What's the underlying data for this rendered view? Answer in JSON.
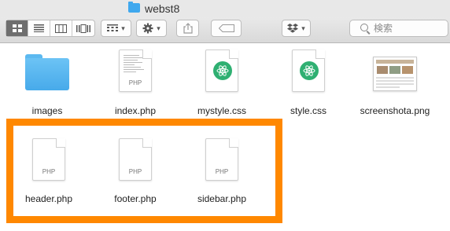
{
  "window": {
    "title": "webst8",
    "title_icon": "folder-icon"
  },
  "toolbar": {
    "view_buttons": [
      {
        "name": "icon-view-button",
        "icon": "grid-icon",
        "active": true
      },
      {
        "name": "list-view-button",
        "icon": "list-icon",
        "active": false
      },
      {
        "name": "column-view-button",
        "icon": "columns-icon",
        "active": false
      },
      {
        "name": "gallery-view-button",
        "icon": "gallery-icon",
        "active": false
      }
    ],
    "group_button_icon": "group-icon",
    "action_button_icon": "gear-icon",
    "share_button_icon": "share-icon",
    "tag_button_icon": "tag-icon",
    "dropbox_button_icon": "dropbox-icon",
    "search": {
      "placeholder": "検索",
      "value": ""
    }
  },
  "files": [
    {
      "name": "images",
      "kind": "folder"
    },
    {
      "name": "index.php",
      "kind": "php-code"
    },
    {
      "name": "mystyle.css",
      "kind": "css"
    },
    {
      "name": "style.css",
      "kind": "css"
    },
    {
      "name": "screenshota.png",
      "kind": "png"
    },
    {
      "name": "header.php",
      "kind": "php"
    },
    {
      "name": "footer.php",
      "kind": "php"
    },
    {
      "name": "sidebar.php",
      "kind": "php"
    }
  ],
  "doc_ext_label": "PHP",
  "colors": {
    "highlight": "#ff8800",
    "folder": "#4fb2ee",
    "css_badge": "#2fb072",
    "active_view": "#6e6e6e"
  }
}
